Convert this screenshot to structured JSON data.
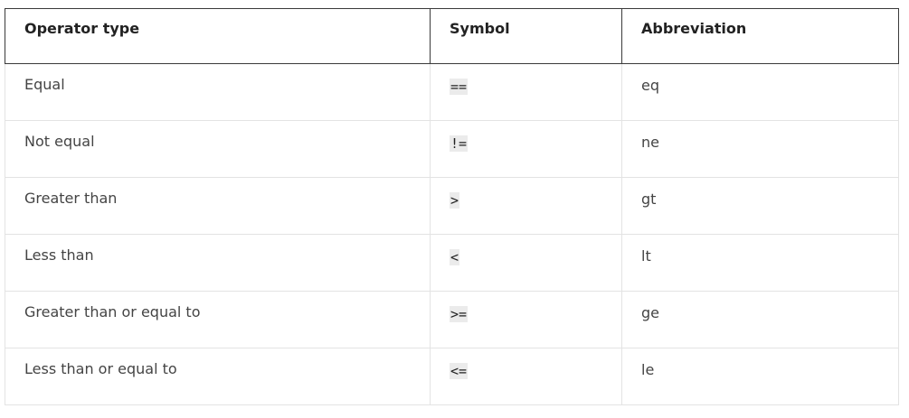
{
  "table": {
    "headers": {
      "operator_type": "Operator type",
      "symbol": "Symbol",
      "abbreviation": "Abbreviation"
    },
    "rows": [
      {
        "operator_type": "Equal",
        "symbol": "==",
        "abbreviation": "eq"
      },
      {
        "operator_type": "Not equal",
        "symbol": "!=",
        "abbreviation": "ne"
      },
      {
        "operator_type": "Greater than",
        "symbol": ">",
        "abbreviation": "gt"
      },
      {
        "operator_type": "Less than",
        "symbol": "<",
        "abbreviation": "lt"
      },
      {
        "operator_type": "Greater than or equal to",
        "symbol": ">=",
        "abbreviation": "ge"
      },
      {
        "operator_type": "Less than or equal to",
        "symbol": "<=",
        "abbreviation": "le"
      }
    ]
  },
  "colors": {
    "header_border": "#3a3a3a",
    "row_border": "#e3e3e3",
    "code_background": "#ebebeb",
    "text": "#444444"
  }
}
